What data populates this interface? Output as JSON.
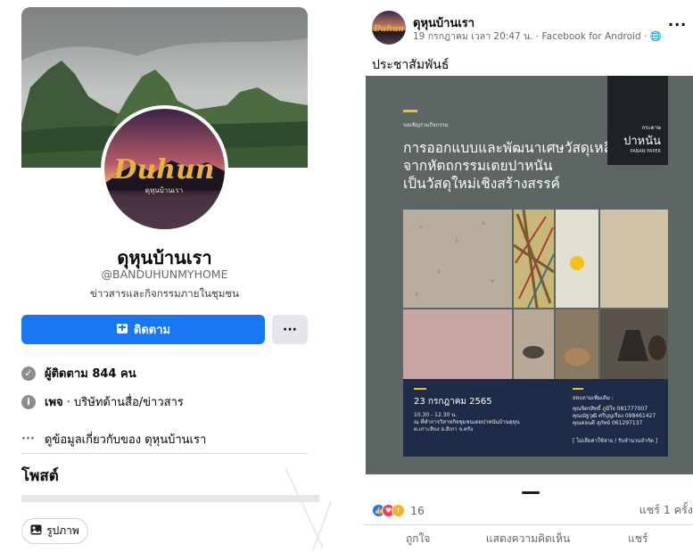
{
  "profile": {
    "logo_text": "Duhun",
    "logo_subtext": "ดุหุนบ้านเรา",
    "name": "ดุหุนบ้านเรา",
    "handle": "@BANDUHUNMYHOME",
    "description": "ข่าวสารและกิจกรรมภายในชุมชน",
    "follow_label": "ติดตาม",
    "more_label": "···",
    "followers_text": "ผู้ติดตาม 844 คน",
    "page_type_bold": "เพจ",
    "page_type_text": " · บริษัทด้านสื่อ/ข่าวสาร",
    "about_text": "ดูข้อมูลเกี่ยวกับของ ดุหุนบ้านเรา",
    "posts_title": "โพสต์",
    "photos_label": "รูปภาพ"
  },
  "post": {
    "author": "ดุหุนบ้านเรา",
    "meta": "19 กรกฎาคม เวลา 20:47 น. · Facebook for Android · 🌐",
    "more_label": "···",
    "text": "ประชาสัมพันธ์",
    "image": {
      "tag_line": "ขอเชิญร่วมกิจกรรม",
      "title_lines": [
        "การออกแบบและพัฒนาเศษวัสดุเหลือใช้",
        "จากหัตถกรรมเตยปาหนัน",
        "เป็นวัสดุใหม่เชิงสร้างสรรค์"
      ],
      "brand_small": "กระดาษ",
      "brand_big": "ปาหนัน",
      "brand_en": "PANAN PAPER",
      "date": "23 กรกฎาคม 2565",
      "time_lines": [
        "10.30 - 12.30 น.",
        "ณ ที่ทำการวิสาหกิจชุมชนเตยปาหนันบ้านดุหุน",
        "ต.เกาะลิบง อ.สิเกา จ.ตรัง"
      ],
      "contact_title": "สอบถามเพิ่มเติม :",
      "contact_lines": [
        "คุณจิตรสิทธิ์ ภูมิใจ   081777007",
        "คุณณัฐวุฒิ ศรีบุญเรือง   098461427",
        "คุณดอนดี สุภัทย์   061297137"
      ],
      "footer_note": "[ ไม่เสียค่าใช้จ่าย / รับจำนวนจำกัด ]"
    },
    "reaction_count": "16",
    "shares_text": "แชร์ 1 ครั้ง",
    "actions": [
      "ถูกใจ",
      "แสดงความคิดเห็น",
      "แชร์"
    ]
  },
  "colors": {
    "accent": "#1877f2",
    "poster_bg": "#5e6565",
    "poster_bottom": "#1f2c49",
    "poster_yellow": "#f2c21b"
  }
}
